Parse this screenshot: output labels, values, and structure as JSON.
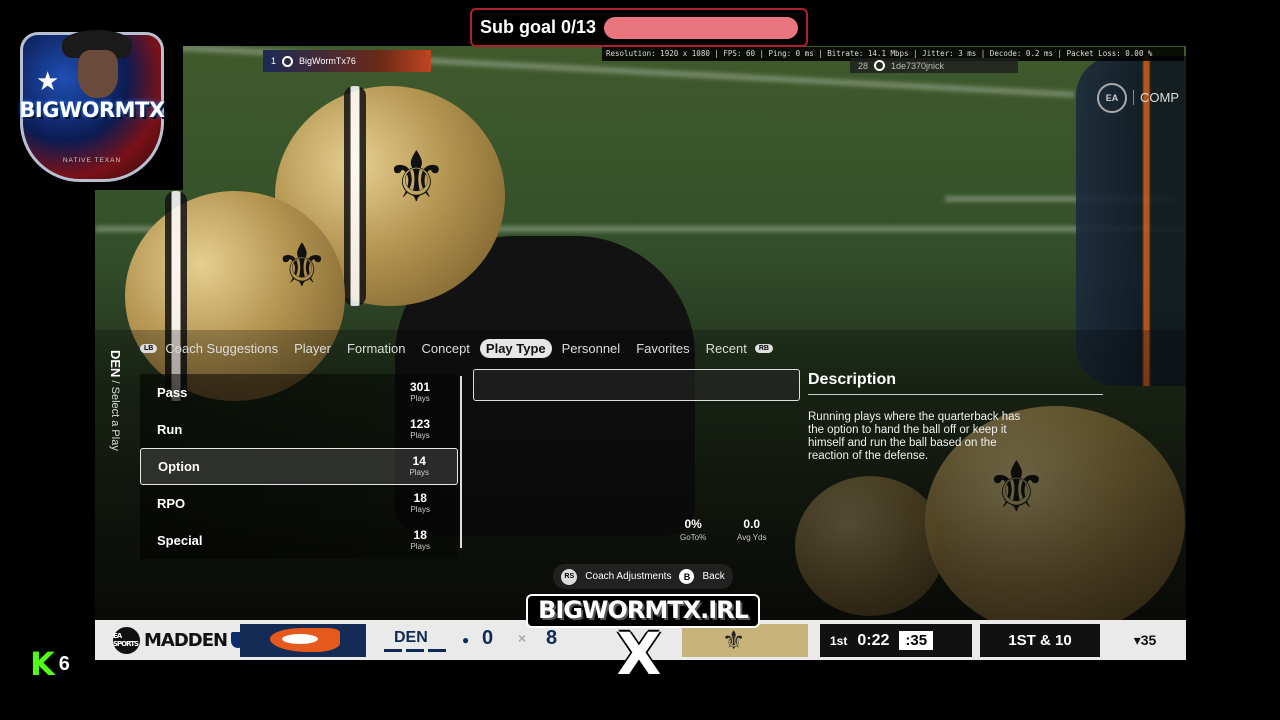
{
  "stream": {
    "subgoal_label": "Sub goal 0/13",
    "stats": "Resolution: 1920 x 1080 | FPS: 60 | Ping: 0 ms | Bitrate: 14.1 Mbps | Jitter: 3 ms | Decode: 0.2 ms | Packet Loss: 0.00 %",
    "logo_text": "BIGWORMTX",
    "logo_subtitle": "NATIVE TEXAN",
    "brand_irl": "BIGWORMTX.IRL",
    "brand_x": "X",
    "kick_count": "6"
  },
  "players": {
    "left": {
      "slot": "1",
      "gamertag": "BigWormTx76"
    },
    "right": {
      "slot": "28",
      "gamertag": "1de7370jnick"
    }
  },
  "game_hud": {
    "ea_badge": "EA",
    "comp_label": "COMP",
    "side_label_team": "DEN",
    "side_label_text": "/ Select a Play"
  },
  "tabs": {
    "left_bumper": "LB",
    "right_bumper": "RB",
    "items": [
      "Coach Suggestions",
      "Player",
      "Formation",
      "Concept",
      "Play Type",
      "Personnel",
      "Favorites",
      "Recent"
    ],
    "active_index": 4
  },
  "play_types": [
    {
      "name": "Pass",
      "count": "301",
      "unit": "Plays"
    },
    {
      "name": "Run",
      "count": "123",
      "unit": "Plays"
    },
    {
      "name": "Option",
      "count": "14",
      "unit": "Plays"
    },
    {
      "name": "RPO",
      "count": "18",
      "unit": "Plays"
    },
    {
      "name": "Special",
      "count": "18",
      "unit": "Plays"
    }
  ],
  "selected_play_type": "Option",
  "metrics": {
    "goto": {
      "value": "0%",
      "label": "GoTo%"
    },
    "avg_yds": {
      "value": "0.0",
      "label": "Avg Yds"
    }
  },
  "description": {
    "title": "Description",
    "body": "Running plays where the quarterback has the option to hand the ball off or keep it himself and run the ball based on the reaction of the defense."
  },
  "hints": {
    "rs": "RS",
    "coach_adjustments": "Coach Adjustments",
    "b": "B",
    "back": "Back"
  },
  "scorebug": {
    "brand": "MADDEN",
    "ea": "EA SPORTS",
    "team_home_abbr": "DEN",
    "score_home": "0",
    "score_away": "8",
    "separator": "×",
    "quarter": "1st",
    "game_clock": "0:22",
    "play_clock": ":35",
    "down_distance": "1ST & 10",
    "ball_on": "▾35"
  }
}
